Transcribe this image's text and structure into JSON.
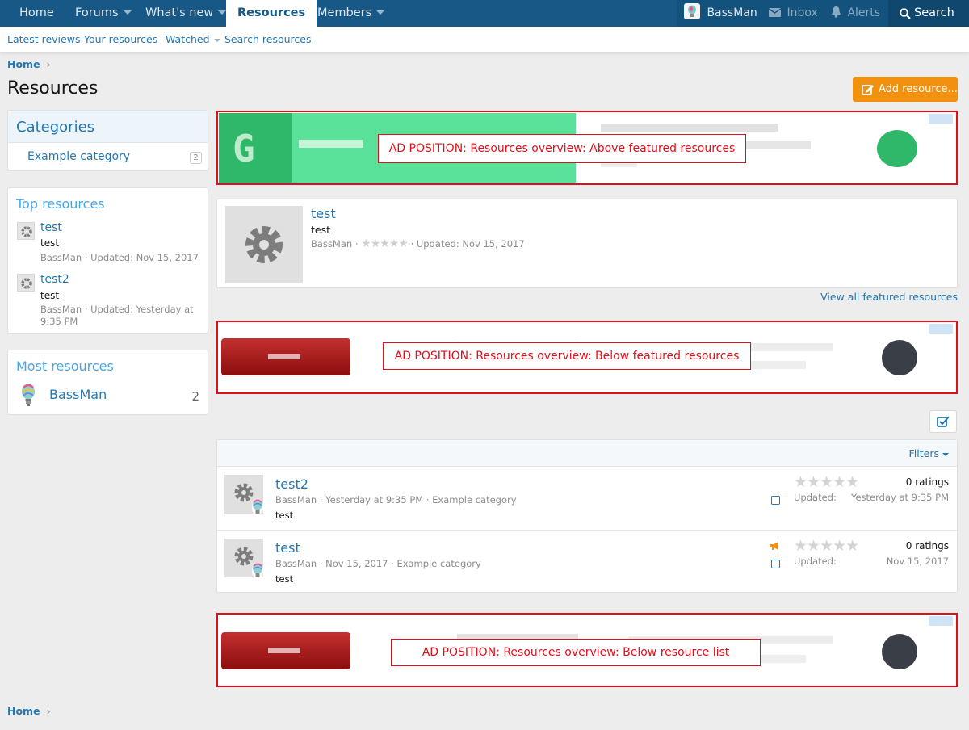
{
  "nav": {
    "home": "Home",
    "forums": "Forums",
    "whats_new": "What's new",
    "resources": "Resources",
    "members": "Members",
    "username": "BassMan",
    "inbox": "Inbox",
    "alerts": "Alerts",
    "search": "Search"
  },
  "subnav": {
    "latest_reviews": "Latest reviews",
    "your_resources": "Your resources",
    "watched": "Watched",
    "search_resources": "Search resources"
  },
  "breadcrumb": {
    "home": "Home"
  },
  "page_title": "Resources",
  "add_resource": "Add resource...",
  "sidebar": {
    "categories": {
      "title": "Categories",
      "items": [
        {
          "label": "Example category",
          "count": "2"
        }
      ]
    },
    "top_resources": {
      "title": "Top resources",
      "items": [
        {
          "title": "test",
          "desc": "test",
          "meta": "BassMan · Updated: Nov 15, 2017"
        },
        {
          "title": "test2",
          "desc": "test",
          "meta": "BassMan · Updated: Yesterday at 9:35 PM"
        }
      ]
    },
    "most_resources": {
      "title": "Most resources",
      "items": [
        {
          "name": "BassMan",
          "count": "2"
        }
      ]
    }
  },
  "ads": {
    "above_featured": "AD POSITION: Resources overview: Above featured resources",
    "below_featured": "AD POSITION: Resources overview: Below featured resources",
    "below_list": "AD POSITION: Resources overview: Below resource list",
    "top_letter": "G"
  },
  "featured": {
    "title": "test",
    "desc": "test",
    "author": "BassMan",
    "updated": "Updated: Nov 15, 2017",
    "rating": 0,
    "view_all": "View all featured resources"
  },
  "list": {
    "filters": "Filters",
    "rows": [
      {
        "title": "test2",
        "author": "BassMan",
        "date": "Yesterday at 9:35 PM",
        "category": "Example category",
        "desc": "test",
        "ratings": "0 ratings",
        "updated_label": "Updated:",
        "updated": "Yesterday at 9:35 PM",
        "featured": false
      },
      {
        "title": "test",
        "author": "BassMan",
        "date": "Nov 15, 2017",
        "category": "Example category",
        "desc": "test",
        "ratings": "0 ratings",
        "updated_label": "Updated:",
        "updated": "Nov 15, 2017",
        "featured": true
      }
    ]
  },
  "colors": {
    "nav_bg": "#185886",
    "accent": "#2577b1",
    "add_button": "#f1910f",
    "ad_border": "#e0101a"
  }
}
